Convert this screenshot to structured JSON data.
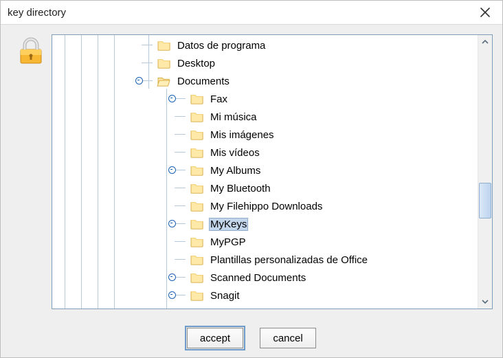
{
  "window": {
    "title": "key directory"
  },
  "buttons": {
    "accept": "accept",
    "cancel": "cancel"
  },
  "selected": "MyKeys",
  "tree": {
    "visible_root_level": [
      {
        "label": "Datos de programa",
        "expandable": false
      },
      {
        "label": "Desktop",
        "expandable": false
      },
      {
        "label": "Documents",
        "expandable": true,
        "expanded": true
      }
    ],
    "documents_children": [
      {
        "label": "Fax",
        "expandable": true
      },
      {
        "label": "Mi música",
        "expandable": false
      },
      {
        "label": "Mis imágenes",
        "expandable": false
      },
      {
        "label": "Mis vídeos",
        "expandable": false
      },
      {
        "label": "My Albums",
        "expandable": true
      },
      {
        "label": "My Bluetooth",
        "expandable": false
      },
      {
        "label": "My Filehippo Downloads",
        "expandable": false
      },
      {
        "label": "MyKeys",
        "expandable": true,
        "selected": true
      },
      {
        "label": "MyPGP",
        "expandable": false
      },
      {
        "label": "Plantillas personalizadas de Office",
        "expandable": false
      },
      {
        "label": "Scanned Documents",
        "expandable": true
      },
      {
        "label": "Snagit",
        "expandable": true
      }
    ]
  },
  "icons": {
    "folder_closed": "folder-closed",
    "folder_open": "folder-open"
  }
}
